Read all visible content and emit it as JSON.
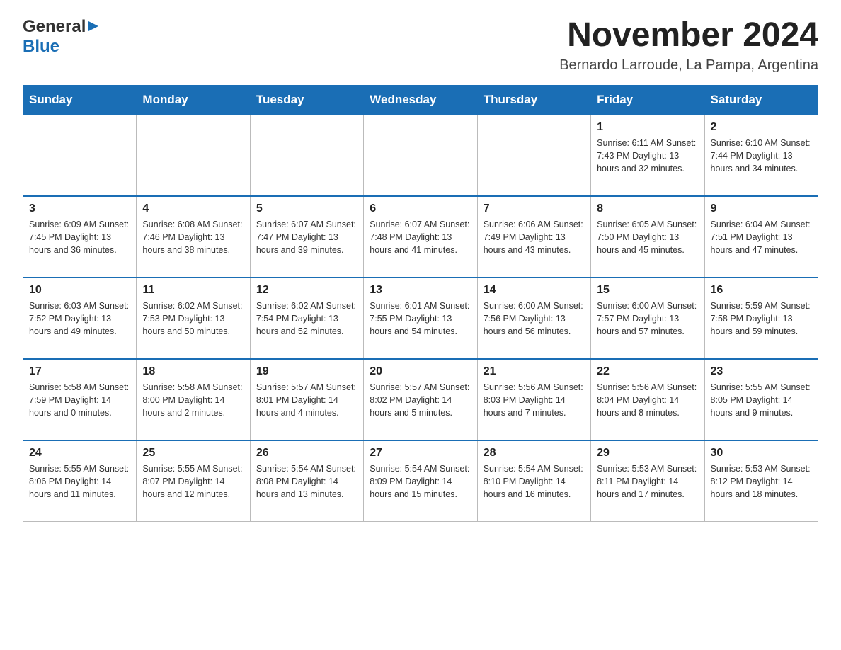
{
  "logo": {
    "general": "General",
    "blue": "Blue",
    "arrow": "▶"
  },
  "header": {
    "month_year": "November 2024",
    "location": "Bernardo Larroude, La Pampa, Argentina"
  },
  "weekdays": [
    "Sunday",
    "Monday",
    "Tuesday",
    "Wednesday",
    "Thursday",
    "Friday",
    "Saturday"
  ],
  "weeks": [
    [
      {
        "day": "",
        "info": ""
      },
      {
        "day": "",
        "info": ""
      },
      {
        "day": "",
        "info": ""
      },
      {
        "day": "",
        "info": ""
      },
      {
        "day": "",
        "info": ""
      },
      {
        "day": "1",
        "info": "Sunrise: 6:11 AM\nSunset: 7:43 PM\nDaylight: 13 hours\nand 32 minutes."
      },
      {
        "day": "2",
        "info": "Sunrise: 6:10 AM\nSunset: 7:44 PM\nDaylight: 13 hours\nand 34 minutes."
      }
    ],
    [
      {
        "day": "3",
        "info": "Sunrise: 6:09 AM\nSunset: 7:45 PM\nDaylight: 13 hours\nand 36 minutes."
      },
      {
        "day": "4",
        "info": "Sunrise: 6:08 AM\nSunset: 7:46 PM\nDaylight: 13 hours\nand 38 minutes."
      },
      {
        "day": "5",
        "info": "Sunrise: 6:07 AM\nSunset: 7:47 PM\nDaylight: 13 hours\nand 39 minutes."
      },
      {
        "day": "6",
        "info": "Sunrise: 6:07 AM\nSunset: 7:48 PM\nDaylight: 13 hours\nand 41 minutes."
      },
      {
        "day": "7",
        "info": "Sunrise: 6:06 AM\nSunset: 7:49 PM\nDaylight: 13 hours\nand 43 minutes."
      },
      {
        "day": "8",
        "info": "Sunrise: 6:05 AM\nSunset: 7:50 PM\nDaylight: 13 hours\nand 45 minutes."
      },
      {
        "day": "9",
        "info": "Sunrise: 6:04 AM\nSunset: 7:51 PM\nDaylight: 13 hours\nand 47 minutes."
      }
    ],
    [
      {
        "day": "10",
        "info": "Sunrise: 6:03 AM\nSunset: 7:52 PM\nDaylight: 13 hours\nand 49 minutes."
      },
      {
        "day": "11",
        "info": "Sunrise: 6:02 AM\nSunset: 7:53 PM\nDaylight: 13 hours\nand 50 minutes."
      },
      {
        "day": "12",
        "info": "Sunrise: 6:02 AM\nSunset: 7:54 PM\nDaylight: 13 hours\nand 52 minutes."
      },
      {
        "day": "13",
        "info": "Sunrise: 6:01 AM\nSunset: 7:55 PM\nDaylight: 13 hours\nand 54 minutes."
      },
      {
        "day": "14",
        "info": "Sunrise: 6:00 AM\nSunset: 7:56 PM\nDaylight: 13 hours\nand 56 minutes."
      },
      {
        "day": "15",
        "info": "Sunrise: 6:00 AM\nSunset: 7:57 PM\nDaylight: 13 hours\nand 57 minutes."
      },
      {
        "day": "16",
        "info": "Sunrise: 5:59 AM\nSunset: 7:58 PM\nDaylight: 13 hours\nand 59 minutes."
      }
    ],
    [
      {
        "day": "17",
        "info": "Sunrise: 5:58 AM\nSunset: 7:59 PM\nDaylight: 14 hours\nand 0 minutes."
      },
      {
        "day": "18",
        "info": "Sunrise: 5:58 AM\nSunset: 8:00 PM\nDaylight: 14 hours\nand 2 minutes."
      },
      {
        "day": "19",
        "info": "Sunrise: 5:57 AM\nSunset: 8:01 PM\nDaylight: 14 hours\nand 4 minutes."
      },
      {
        "day": "20",
        "info": "Sunrise: 5:57 AM\nSunset: 8:02 PM\nDaylight: 14 hours\nand 5 minutes."
      },
      {
        "day": "21",
        "info": "Sunrise: 5:56 AM\nSunset: 8:03 PM\nDaylight: 14 hours\nand 7 minutes."
      },
      {
        "day": "22",
        "info": "Sunrise: 5:56 AM\nSunset: 8:04 PM\nDaylight: 14 hours\nand 8 minutes."
      },
      {
        "day": "23",
        "info": "Sunrise: 5:55 AM\nSunset: 8:05 PM\nDaylight: 14 hours\nand 9 minutes."
      }
    ],
    [
      {
        "day": "24",
        "info": "Sunrise: 5:55 AM\nSunset: 8:06 PM\nDaylight: 14 hours\nand 11 minutes."
      },
      {
        "day": "25",
        "info": "Sunrise: 5:55 AM\nSunset: 8:07 PM\nDaylight: 14 hours\nand 12 minutes."
      },
      {
        "day": "26",
        "info": "Sunrise: 5:54 AM\nSunset: 8:08 PM\nDaylight: 14 hours\nand 13 minutes."
      },
      {
        "day": "27",
        "info": "Sunrise: 5:54 AM\nSunset: 8:09 PM\nDaylight: 14 hours\nand 15 minutes."
      },
      {
        "day": "28",
        "info": "Sunrise: 5:54 AM\nSunset: 8:10 PM\nDaylight: 14 hours\nand 16 minutes."
      },
      {
        "day": "29",
        "info": "Sunrise: 5:53 AM\nSunset: 8:11 PM\nDaylight: 14 hours\nand 17 minutes."
      },
      {
        "day": "30",
        "info": "Sunrise: 5:53 AM\nSunset: 8:12 PM\nDaylight: 14 hours\nand 18 minutes."
      }
    ]
  ]
}
